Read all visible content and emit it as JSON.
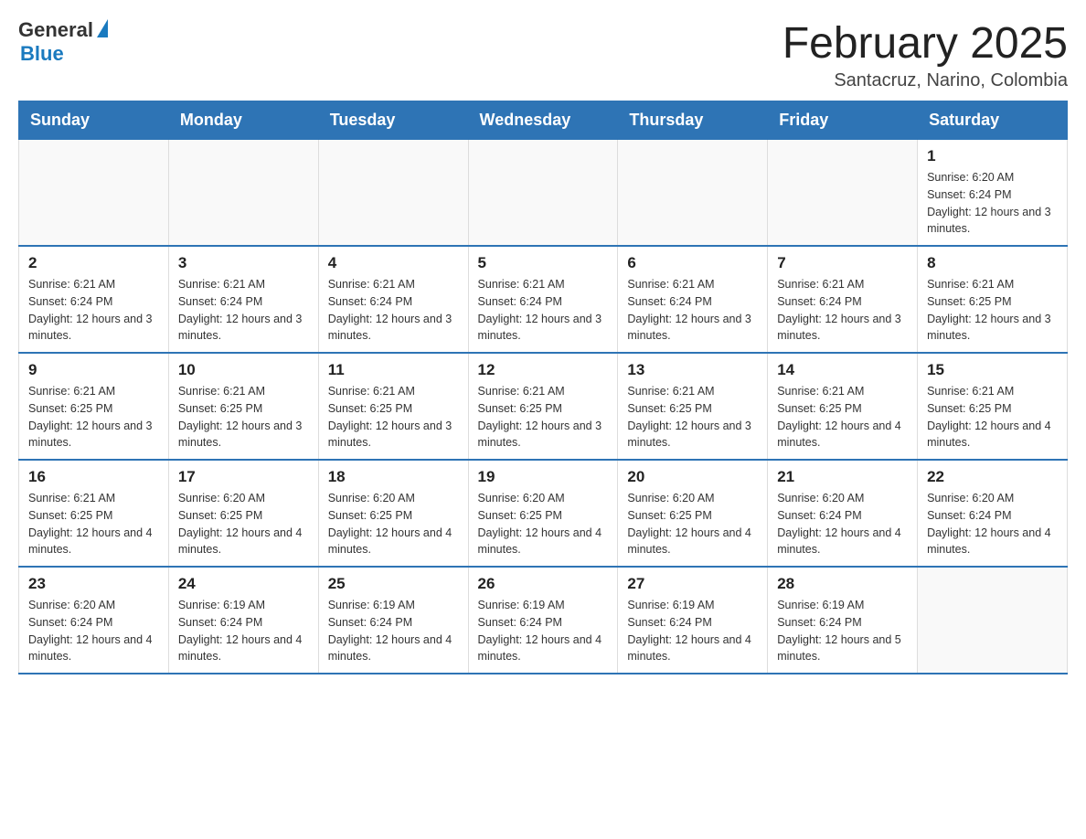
{
  "logo": {
    "general": "General",
    "blue": "Blue"
  },
  "title": "February 2025",
  "subtitle": "Santacruz, Narino, Colombia",
  "days_of_week": [
    "Sunday",
    "Monday",
    "Tuesday",
    "Wednesday",
    "Thursday",
    "Friday",
    "Saturday"
  ],
  "weeks": [
    [
      {
        "day": "",
        "info": ""
      },
      {
        "day": "",
        "info": ""
      },
      {
        "day": "",
        "info": ""
      },
      {
        "day": "",
        "info": ""
      },
      {
        "day": "",
        "info": ""
      },
      {
        "day": "",
        "info": ""
      },
      {
        "day": "1",
        "info": "Sunrise: 6:20 AM\nSunset: 6:24 PM\nDaylight: 12 hours and 3 minutes."
      }
    ],
    [
      {
        "day": "2",
        "info": "Sunrise: 6:21 AM\nSunset: 6:24 PM\nDaylight: 12 hours and 3 minutes."
      },
      {
        "day": "3",
        "info": "Sunrise: 6:21 AM\nSunset: 6:24 PM\nDaylight: 12 hours and 3 minutes."
      },
      {
        "day": "4",
        "info": "Sunrise: 6:21 AM\nSunset: 6:24 PM\nDaylight: 12 hours and 3 minutes."
      },
      {
        "day": "5",
        "info": "Sunrise: 6:21 AM\nSunset: 6:24 PM\nDaylight: 12 hours and 3 minutes."
      },
      {
        "day": "6",
        "info": "Sunrise: 6:21 AM\nSunset: 6:24 PM\nDaylight: 12 hours and 3 minutes."
      },
      {
        "day": "7",
        "info": "Sunrise: 6:21 AM\nSunset: 6:24 PM\nDaylight: 12 hours and 3 minutes."
      },
      {
        "day": "8",
        "info": "Sunrise: 6:21 AM\nSunset: 6:25 PM\nDaylight: 12 hours and 3 minutes."
      }
    ],
    [
      {
        "day": "9",
        "info": "Sunrise: 6:21 AM\nSunset: 6:25 PM\nDaylight: 12 hours and 3 minutes."
      },
      {
        "day": "10",
        "info": "Sunrise: 6:21 AM\nSunset: 6:25 PM\nDaylight: 12 hours and 3 minutes."
      },
      {
        "day": "11",
        "info": "Sunrise: 6:21 AM\nSunset: 6:25 PM\nDaylight: 12 hours and 3 minutes."
      },
      {
        "day": "12",
        "info": "Sunrise: 6:21 AM\nSunset: 6:25 PM\nDaylight: 12 hours and 3 minutes."
      },
      {
        "day": "13",
        "info": "Sunrise: 6:21 AM\nSunset: 6:25 PM\nDaylight: 12 hours and 3 minutes."
      },
      {
        "day": "14",
        "info": "Sunrise: 6:21 AM\nSunset: 6:25 PM\nDaylight: 12 hours and 4 minutes."
      },
      {
        "day": "15",
        "info": "Sunrise: 6:21 AM\nSunset: 6:25 PM\nDaylight: 12 hours and 4 minutes."
      }
    ],
    [
      {
        "day": "16",
        "info": "Sunrise: 6:21 AM\nSunset: 6:25 PM\nDaylight: 12 hours and 4 minutes."
      },
      {
        "day": "17",
        "info": "Sunrise: 6:20 AM\nSunset: 6:25 PM\nDaylight: 12 hours and 4 minutes."
      },
      {
        "day": "18",
        "info": "Sunrise: 6:20 AM\nSunset: 6:25 PM\nDaylight: 12 hours and 4 minutes."
      },
      {
        "day": "19",
        "info": "Sunrise: 6:20 AM\nSunset: 6:25 PM\nDaylight: 12 hours and 4 minutes."
      },
      {
        "day": "20",
        "info": "Sunrise: 6:20 AM\nSunset: 6:25 PM\nDaylight: 12 hours and 4 minutes."
      },
      {
        "day": "21",
        "info": "Sunrise: 6:20 AM\nSunset: 6:24 PM\nDaylight: 12 hours and 4 minutes."
      },
      {
        "day": "22",
        "info": "Sunrise: 6:20 AM\nSunset: 6:24 PM\nDaylight: 12 hours and 4 minutes."
      }
    ],
    [
      {
        "day": "23",
        "info": "Sunrise: 6:20 AM\nSunset: 6:24 PM\nDaylight: 12 hours and 4 minutes."
      },
      {
        "day": "24",
        "info": "Sunrise: 6:19 AM\nSunset: 6:24 PM\nDaylight: 12 hours and 4 minutes."
      },
      {
        "day": "25",
        "info": "Sunrise: 6:19 AM\nSunset: 6:24 PM\nDaylight: 12 hours and 4 minutes."
      },
      {
        "day": "26",
        "info": "Sunrise: 6:19 AM\nSunset: 6:24 PM\nDaylight: 12 hours and 4 minutes."
      },
      {
        "day": "27",
        "info": "Sunrise: 6:19 AM\nSunset: 6:24 PM\nDaylight: 12 hours and 4 minutes."
      },
      {
        "day": "28",
        "info": "Sunrise: 6:19 AM\nSunset: 6:24 PM\nDaylight: 12 hours and 5 minutes."
      },
      {
        "day": "",
        "info": ""
      }
    ]
  ]
}
